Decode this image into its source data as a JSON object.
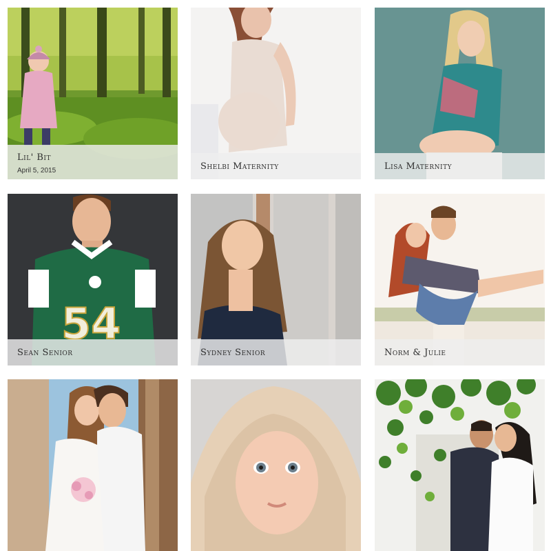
{
  "gallery": {
    "items": [
      {
        "title": "Lil' Bit",
        "date": "April 5, 2015"
      },
      {
        "title": "Shelbi Maternity"
      },
      {
        "title": "Lisa Maternity"
      },
      {
        "title": "Sean Senior",
        "jersey_number": "54"
      },
      {
        "title": "Sydney Senior"
      },
      {
        "title": "Norm & Julie"
      },
      {
        "title": ""
      },
      {
        "title": ""
      },
      {
        "title": ""
      }
    ]
  }
}
